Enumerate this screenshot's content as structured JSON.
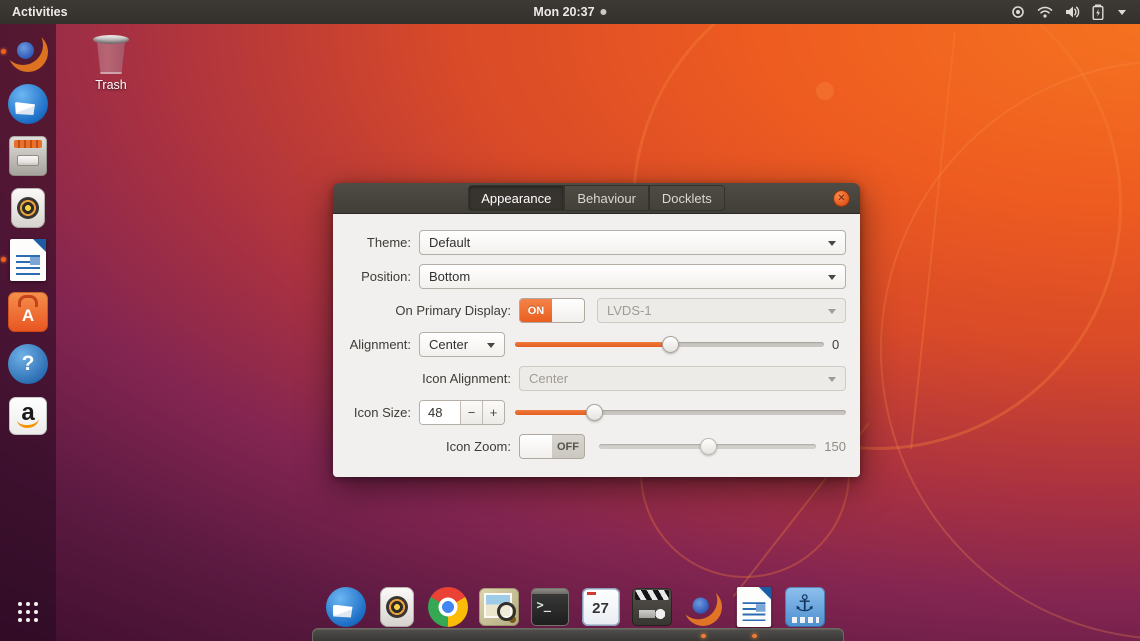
{
  "topbar": {
    "activities_label": "Activities",
    "clock": "Mon 20:37",
    "status_icons": [
      "location-icon",
      "wifi-icon",
      "volume-icon",
      "battery-icon",
      "chevron-down-icon"
    ]
  },
  "desktop": {
    "trash_label": "Trash"
  },
  "launcher": {
    "items": [
      {
        "name": "firefox",
        "running": true
      },
      {
        "name": "thunderbird",
        "running": false
      },
      {
        "name": "files",
        "running": false
      },
      {
        "name": "rhythmbox",
        "running": false
      },
      {
        "name": "libreoffice-writer",
        "running": true
      },
      {
        "name": "ubuntu-software",
        "running": false
      },
      {
        "name": "help",
        "running": false
      },
      {
        "name": "amazon",
        "running": false
      }
    ]
  },
  "icon_glyphs": {
    "software": "A",
    "help": "?",
    "amazon": "a",
    "terminal": ">_",
    "anchor": "⚓",
    "calendar_day": "27"
  },
  "dialog": {
    "tabs": [
      {
        "label": "Appearance",
        "active": true
      },
      {
        "label": "Behaviour",
        "active": false
      },
      {
        "label": "Docklets",
        "active": false
      }
    ],
    "theme": {
      "label": "Theme:",
      "value": "Default"
    },
    "position": {
      "label": "Position:",
      "value": "Bottom"
    },
    "primary_display": {
      "label": "On Primary Display:",
      "toggle_state": "ON",
      "display_value": "LVDS-1"
    },
    "alignment": {
      "label": "Alignment:",
      "value": "Center",
      "slider_value": "0",
      "handle_pos": "50%"
    },
    "icon_alignment": {
      "label": "Icon Alignment:",
      "value": "Center"
    },
    "icon_size": {
      "label": "Icon Size:",
      "value": "48",
      "minus_label": "−",
      "plus_label": "+",
      "handle_pos": "24%"
    },
    "icon_zoom": {
      "label": "Icon Zoom:",
      "toggle_state": "OFF",
      "slider_value": "150",
      "handle_pos": "50%"
    },
    "accent_color": "#e95420"
  },
  "dock": {
    "items": [
      {
        "name": "thunderbird",
        "running": false
      },
      {
        "name": "rhythmbox",
        "running": false
      },
      {
        "name": "chrome",
        "running": false
      },
      {
        "name": "screenshot-tool",
        "running": false
      },
      {
        "name": "terminal",
        "running": false
      },
      {
        "name": "calendar",
        "running": false
      },
      {
        "name": "video-editor",
        "running": false
      },
      {
        "name": "firefox",
        "running": true
      },
      {
        "name": "libreoffice-writer",
        "running": true
      },
      {
        "name": "anchor-docklet",
        "running": false
      }
    ]
  }
}
